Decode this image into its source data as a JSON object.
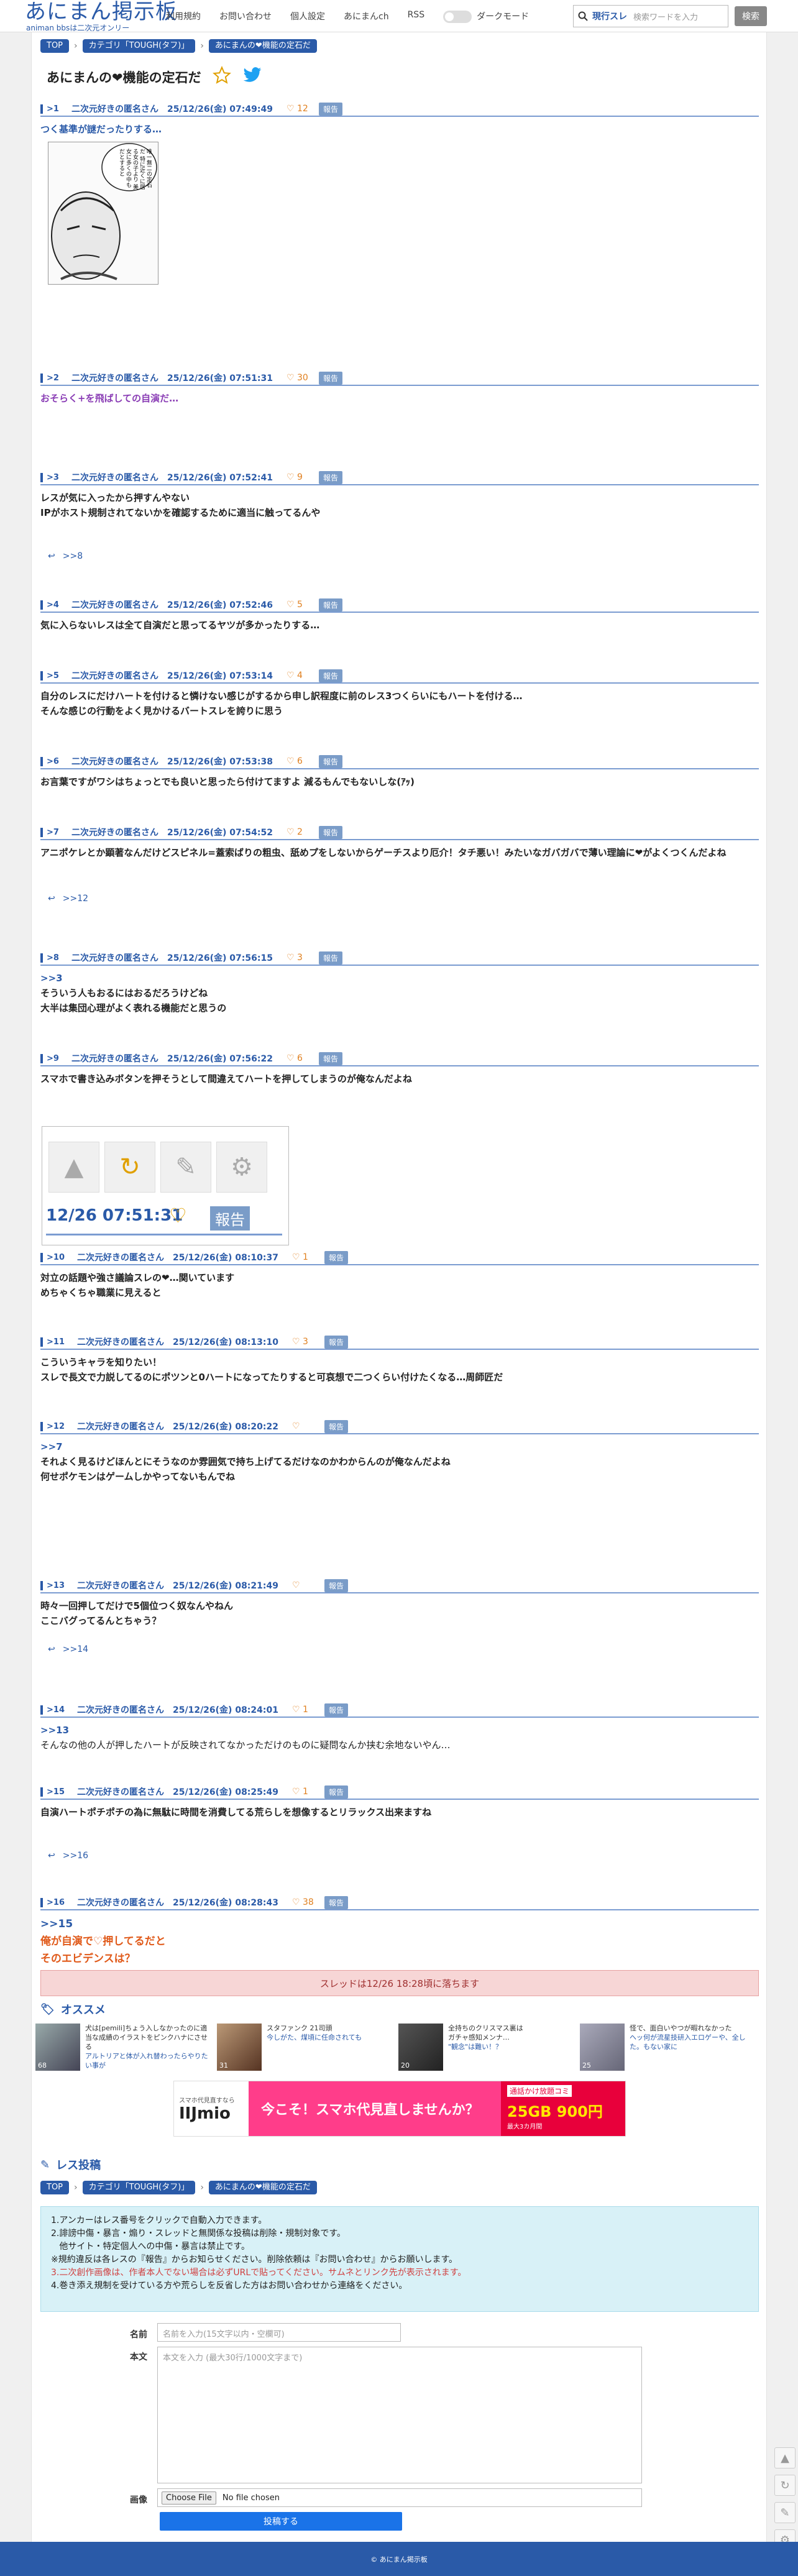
{
  "header": {
    "logo": "あにまん掲示板",
    "logo_sub": "animan bbsは二次元オンリー",
    "nav": [
      "利用規約",
      "お問い合わせ",
      "個人設定",
      "あにまんch",
      "RSS"
    ],
    "dark_mode": "ダークモード",
    "search_prefix": "現行スレ",
    "search_placeholder": "検索ワードを入力",
    "search_button": "検索"
  },
  "breadcrumb": [
    "TOP",
    "カテゴリ「TOUGH(タフ)」",
    "あにまんの❤機能の定石だ"
  ],
  "thread_title": "あにまんの❤機能の定石だ",
  "posts": [
    {
      "num": ">1",
      "name": "二次元好きの匿名さん",
      "date": "25/12/26(金) 07:49:49",
      "likes": "12",
      "report": "報告",
      "lines": [
        "つく基準が謎だったりする…"
      ],
      "image_text": "唯一無二の定石だ 特に近くに居る女の子より 美女に多くの中も だとすると"
    },
    {
      "num": ">2",
      "name": "二次元好きの匿名さん",
      "date": "25/12/26(金) 07:51:31",
      "likes": "30",
      "report": "報告",
      "lines": [
        "おそらく+を飛ばしての自演だ…"
      ]
    },
    {
      "num": ">3",
      "name": "二次元好きの匿名さん",
      "date": "25/12/26(金) 07:52:41",
      "likes": "9",
      "report": "報告",
      "lines": [
        "レスが気に入ったから押すんやない",
        "IPがホスト規制されてないかを確認するために適当に触ってるんや"
      ],
      "replies": ">>8"
    },
    {
      "num": ">4",
      "name": "二次元好きの匿名さん",
      "date": "25/12/26(金) 07:52:46",
      "likes": "5",
      "report": "報告",
      "lines": [
        "気に入らないレスは全て自演だと思ってるヤツが多かったりする…"
      ]
    },
    {
      "num": ">5",
      "name": "二次元好きの匿名さん",
      "date": "25/12/26(金) 07:53:14",
      "likes": "4",
      "report": "報告",
      "lines": [
        "自分のレスにだけハートを付けると憐けない感じがするから申し訳程度に前のレス3つくらいにもハートを付ける…",
        "そんな感じの行動をよく見かけるバートスレを誇りに思う"
      ]
    },
    {
      "num": ">6",
      "name": "二次元好きの匿名さん",
      "date": "25/12/26(金) 07:53:38",
      "likes": "6",
      "report": "報告",
      "lines": [
        "お言葉ですがワシはちょっとでも良いと思ったら付けてますよ 減るもんでもないしな(ｱｯ)"
      ]
    },
    {
      "num": ">7",
      "name": "二次元好きの匿名さん",
      "date": "25/12/26(金) 07:54:52",
      "likes": "2",
      "report": "報告",
      "lines": [
        "アニポケレとか顕著なんだけどスピネル=蓋索ばりの粗虫、舐めプをしないからゲーチスより厄介！タチ悪い！みたいなガバガバで薄い理論に❤がよくつくんだよね"
      ],
      "replies": ">>12"
    },
    {
      "num": ">8",
      "name": "二次元好きの匿名さん",
      "date": "25/12/26(金) 07:56:15",
      "likes": "3",
      "report": "報告",
      "anchor": ">>3",
      "lines": [
        "そういう人もおるにはおるだろうけどね",
        "大半は集団心理がよく表れる機能だと思うの"
      ]
    },
    {
      "num": ">9",
      "name": "二次元好きの匿名さん",
      "date": "25/12/26(金) 07:56:22",
      "likes": "6",
      "report": "報告",
      "lines": [
        "スマホで書き込みボタンを押そうとして間違えてハートを押してしまうのが俺なんだよね"
      ],
      "shot_date": "12/26 07:51:31",
      "shot_report": "報告"
    },
    {
      "num": ">10",
      "name": "二次元好きの匿名さん",
      "date": "25/12/26(金) 08:10:37",
      "likes": "1",
      "report": "報告",
      "lines": [
        "対立の話題や強さ議論スレの❤…関いています",
        "めちゃくちゃ職業に見えると"
      ]
    },
    {
      "num": ">11",
      "name": "二次元好きの匿名さん",
      "date": "25/12/26(金) 08:13:10",
      "likes": "3",
      "report": "報告",
      "lines": [
        "こういうキャラを知りたい！",
        "スレで長文で力説してるのにポツンと0ハートになってたりすると可哀想で二つくらい付けたくなる…周師匠だ"
      ]
    },
    {
      "num": ">12",
      "name": "二次元好きの匿名さん",
      "date": "25/12/26(金) 08:20:22",
      "likes": "",
      "report": "報告",
      "anchor": ">>7",
      "lines": [
        "それよく見るけどほんとにそうなのか雰囲気で持ち上げてるだけなのかわからんのが俺なんだよね",
        "何せポケモンはゲームしかやってないもんでね"
      ]
    },
    {
      "num": ">13",
      "name": "二次元好きの匿名さん",
      "date": "25/12/26(金) 08:21:49",
      "likes": "",
      "report": "報告",
      "lines": [
        "時々一回押してだけで5個位つく奴なんやねん",
        "ここバグってるんとちゃう？"
      ],
      "replies": ">>14"
    },
    {
      "num": ">14",
      "name": "二次元好きの匿名さん",
      "date": "25/12/26(金) 08:24:01",
      "likes": "1",
      "report": "報告",
      "anchor": ">>13",
      "lines": [
        "そんなの他の人が押したハートが反映されてなかっただけのものに疑問なんか挟む余地ないやん…"
      ]
    },
    {
      "num": ">15",
      "name": "二次元好きの匿名さん",
      "date": "25/12/26(金) 08:25:49",
      "likes": "1",
      "report": "報告",
      "lines": [
        "自演ハートポチポチの為に無駄に時間を消費してる荒らしを想像するとリラックス出来ますね"
      ],
      "replies": ">>16"
    },
    {
      "num": ">16",
      "name": "二次元好きの匿名さん",
      "date": "25/12/26(金) 08:28:43",
      "likes": "38",
      "report": "報告",
      "anchor": ">>15",
      "lines": [
        "俺が自演で♡押してるだと",
        "そのエビデンスは？"
      ]
    }
  ],
  "deadline": "スレッドは12/26 18:28頃に落ちます",
  "recommend_title": "オススメ",
  "recommend": [
    {
      "title": "犬は[pemili]ちょう入しなかったのに適当な成績のイラストをピンクハナにさせる",
      "sub": "アルトリアと体が入れ替わったらやりたい事が",
      "count": "68"
    },
    {
      "title": "スタファンク 21司頭",
      "sub": "今しがた、煤頃に任命されても",
      "count": "31"
    },
    {
      "title": "全持ちのクリスマス裏は"
    },
    {
      "title": "ガチャ感知メンナ…",
      "sub": "\"観念\"は難い！？",
      "count": "20"
    },
    {
      "title": "怪で、面白いやつが暇れなかった",
      "sub": "ヘッ何が流星技研入エロゲーや、全した。もない家に",
      "count": "25"
    }
  ],
  "ad": {
    "brand": "IIJmio",
    "small": "スマホ代見直すなら",
    "headline": "今こそ！スマホ代見直しませんか？",
    "badge": "通話かけ放題コミ",
    "price": "25GB 900円",
    "note": "最大3カ月間"
  },
  "form": {
    "title": "レス投稿",
    "notes": [
      "1.アンカーはレス番号をクリックで自動入力できます。",
      "2.誹謗中傷・暴言・煽り・スレッドと無関係な投稿は削除・規制対象です。",
      "   他サイト・特定個人への中傷・暴言は禁止です。",
      "※規約違反は各レスの『報告』からお知らせください。削除依頼は『お問い合わせ』からお願いします。",
      "3.二次創作画像は、作者本人でない場合は必ずURLで貼ってください。サムネとリンク先が表示されます。",
      "4.巻き添え規制を受けている方や荒らしを反省した方はお問い合わせから連絡をください。"
    ],
    "name_label": "名前",
    "name_placeholder": "名前を入力(15文字以内・空欄可)",
    "body_label": "本文",
    "body_placeholder": "本文を入力 (最大30行/1000文字まで)",
    "image_label": "画像",
    "file_button": "Choose File",
    "file_none": "No file chosen",
    "submit": "投稿する"
  },
  "footer": "© あにまん掲示板"
}
